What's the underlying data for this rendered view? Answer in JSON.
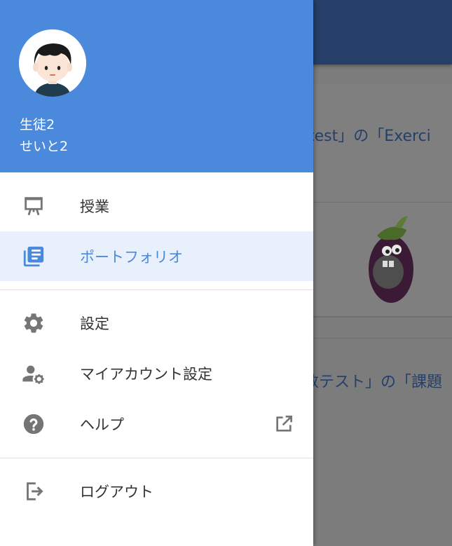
{
  "user": {
    "name": "生徒2",
    "kana": "せいと2"
  },
  "nav": {
    "items": [
      {
        "label": "授業",
        "icon": "presentation-board-icon",
        "active": false
      },
      {
        "label": "ポートフォリオ",
        "icon": "library-books-icon",
        "active": true
      },
      {
        "label": "設定",
        "icon": "gear-icon",
        "active": false
      },
      {
        "label": "マイアカウント設定",
        "icon": "account-settings-icon",
        "active": false
      },
      {
        "label": "ヘルプ",
        "icon": "help-circle-icon",
        "active": false,
        "external": true
      },
      {
        "label": "ログアウト",
        "icon": "logout-icon",
        "active": false
      }
    ]
  },
  "background": {
    "text1": "test」の「Exerci",
    "text2": "数テスト」の「課題"
  },
  "colors": {
    "header": "#4a89dc",
    "active_bg": "#e8f0fb",
    "icon": "#757575",
    "appbar": "#253f68"
  }
}
